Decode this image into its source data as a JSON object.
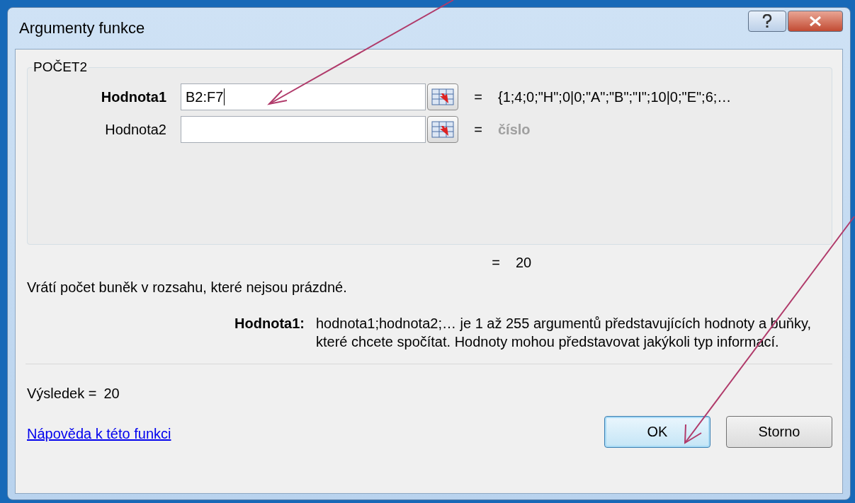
{
  "window": {
    "title": "Argumenty funkce"
  },
  "function": {
    "name": "POČET2",
    "arguments": [
      {
        "label": "Hodnota1",
        "value": "B2:F7",
        "current": true,
        "equals": "=",
        "result": "{1;4;0;\"H\";0|0;\"A\";\"B\";\"I\";10|0;\"E\";6;…",
        "result_is_type": false
      },
      {
        "label": "Hodnota2",
        "current": false,
        "equals": "=",
        "result": "číslo",
        "result_is_type": true
      }
    ]
  },
  "formula_result": {
    "equals": "=",
    "value": "20"
  },
  "description": "Vrátí počet buněk v rozsahu, které nejsou prázdné.",
  "argument_help": {
    "name": "Hodnota1:",
    "text": "hodnota1;hodnota2;… je 1 až 255 argumentů představujících hodnoty a buňky, které chcete spočítat. Hodnoty mohou představovat jakýkoli typ informací."
  },
  "result": {
    "label": "Výsledek =",
    "value": "20"
  },
  "help_link": "Nápověda k této funkci",
  "buttons": [
    {
      "label": "OK",
      "default": true
    },
    {
      "label": "Storno",
      "default": false
    }
  ]
}
